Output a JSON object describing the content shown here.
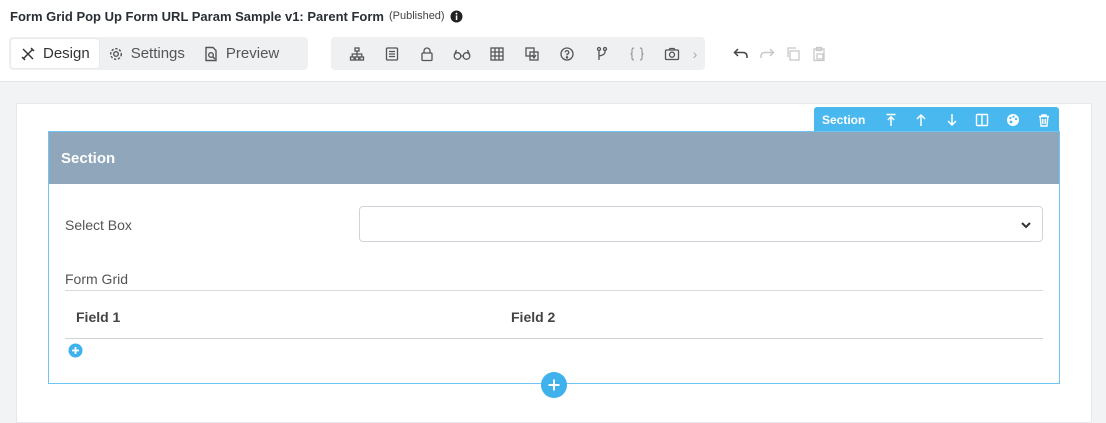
{
  "header": {
    "title": "Form Grid Pop Up Form URL Param Sample v1: Parent Form",
    "status": "(Published)",
    "info_icon": "info-circle-icon"
  },
  "modes": [
    {
      "label": "Design",
      "icon": "design-tools-icon",
      "active": true
    },
    {
      "label": "Settings",
      "icon": "gear-icon",
      "active": false
    },
    {
      "label": "Preview",
      "icon": "preview-document-icon",
      "active": false
    }
  ],
  "toolbar": {
    "tools": [
      "hierarchy-icon",
      "field-list-icon",
      "lock-icon",
      "glasses-icon",
      "grid-icon",
      "translate-icon",
      "help-circle-icon",
      "branch-icon",
      "code-braces-icon",
      "camera-icon"
    ],
    "more": "›"
  },
  "history": [
    "undo-icon",
    "redo-icon",
    "copy-icon",
    "paste-icon"
  ],
  "section_toolbar": {
    "label": "Section",
    "actions": [
      "move-top-icon",
      "arrow-up-icon",
      "arrow-down-icon",
      "columns-icon",
      "palette-icon",
      "trash-icon"
    ]
  },
  "section": {
    "title": "Section",
    "select_box": {
      "label": "Select Box",
      "value": ""
    },
    "form_grid": {
      "label": "Form Grid",
      "columns": [
        "Field 1",
        "Field 2"
      ]
    }
  },
  "colors": {
    "accent": "#49b8ee",
    "section_header": "#8fa6bb",
    "section_border": "#6ec4f2"
  }
}
